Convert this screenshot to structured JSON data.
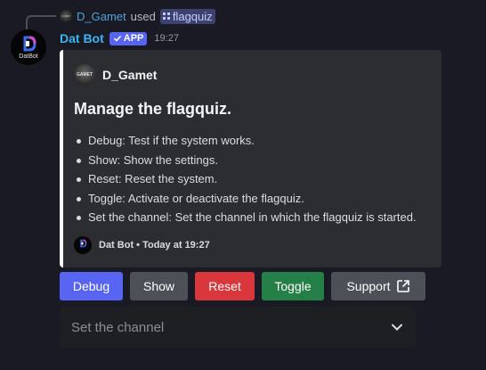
{
  "reply": {
    "avatar_text": "GAMET",
    "user": "D_Gamet",
    "used": "used",
    "command": "flagquiz"
  },
  "header": {
    "avatar_text": "DatBot",
    "bot_name": "Dat Bot",
    "badge": "APP",
    "time": "19:27"
  },
  "embed": {
    "author_icon_text": "GAMET",
    "author": "D_Gamet",
    "title": "Manage the flagquiz.",
    "items": [
      "Debug: Test if the system works.",
      "Show: Show the settings.",
      "Reset: Reset the system.",
      "Toggle: Activate or deactivate the flagquiz.",
      "Set the channel: Set the channel in which the flagquiz is started."
    ],
    "footer_name": "Dat Bot",
    "footer_sep": "•",
    "footer_time": "Today at 19:27",
    "bar_color": "#ffffff"
  },
  "buttons": {
    "debug": "Debug",
    "show": "Show",
    "reset": "Reset",
    "toggle": "Toggle",
    "support": "Support"
  },
  "select": {
    "placeholder": "Set the channel"
  },
  "colors": {
    "blurple": "#5865f2",
    "secondary": "#4e5058",
    "danger": "#da373c",
    "success": "#248046",
    "bot_name": "#38b6ef"
  }
}
